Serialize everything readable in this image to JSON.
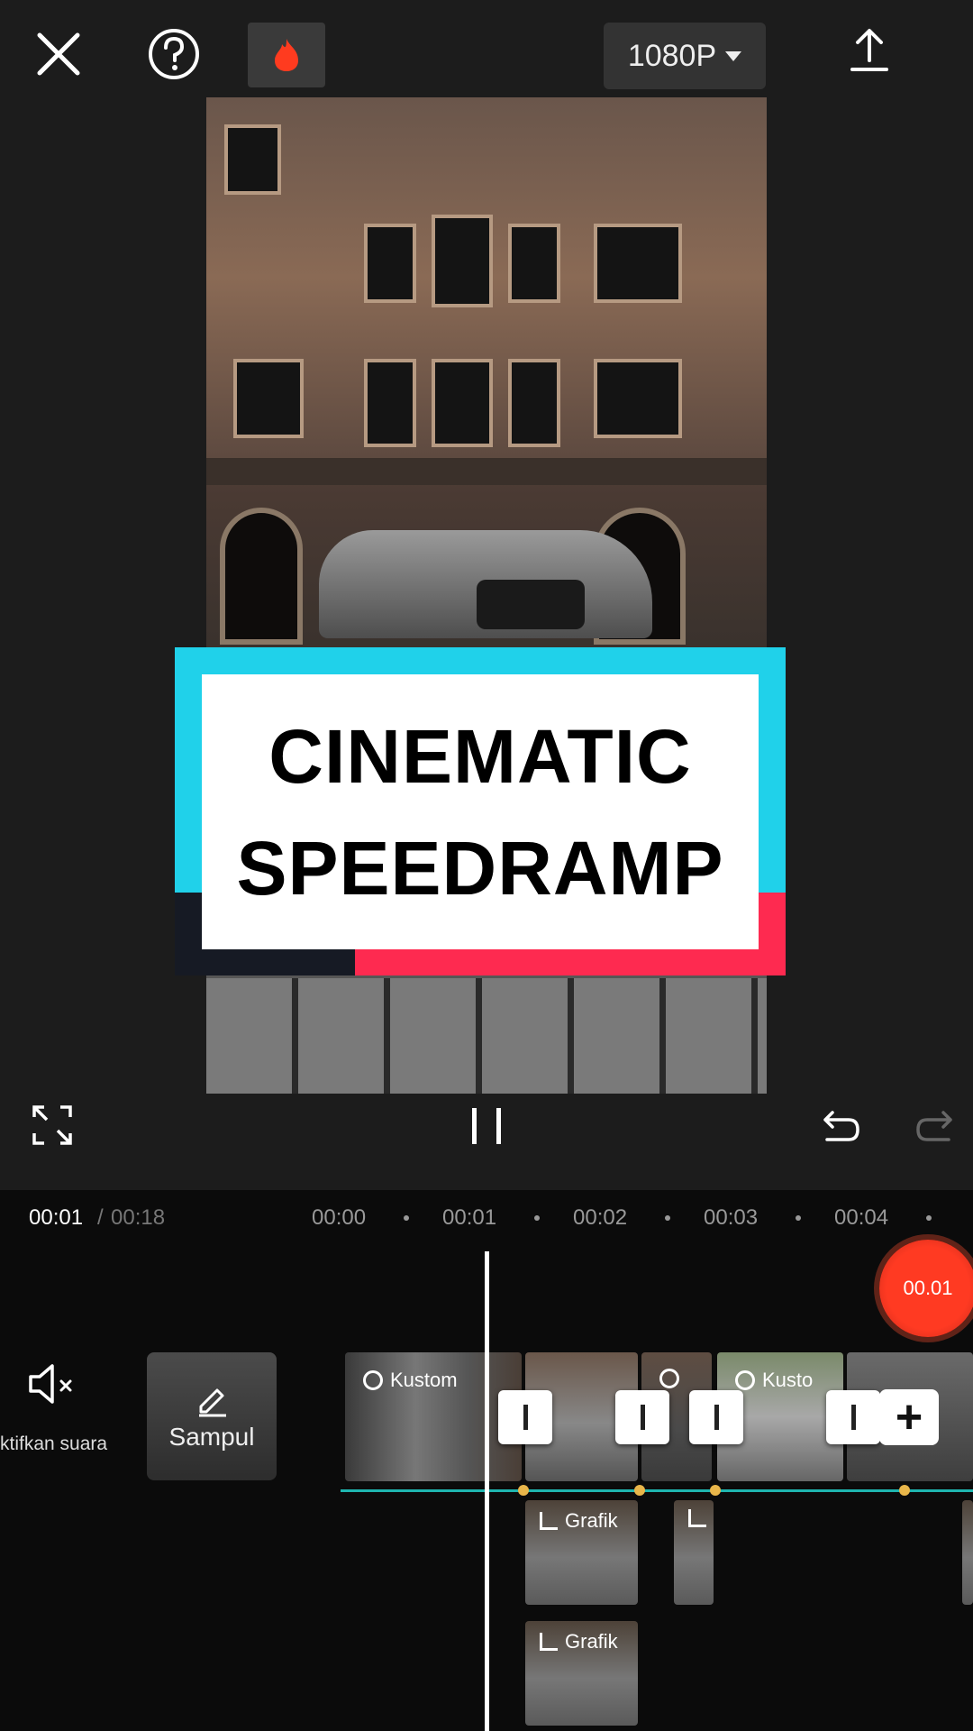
{
  "topbar": {
    "resolution": "1080P"
  },
  "preview": {
    "title_line1": "CINEMATIC",
    "title_line2": "SPEEDRAMP"
  },
  "timeline": {
    "current_time": "00:01",
    "separator": "/",
    "total_time": "00:18",
    "ruler": [
      "00:00",
      "00:01",
      "00:02",
      "00:03",
      "00:04"
    ],
    "record_badge": "00.01",
    "mute_label": "ktifkan suara",
    "cover_label": "Sampul",
    "clips": [
      {
        "label": "Kustom"
      },
      {
        "label": ""
      },
      {
        "label": ""
      },
      {
        "label": "Kusto"
      }
    ],
    "sub_tracks": [
      {
        "label": "Grafik"
      },
      {
        "label": ""
      },
      {
        "label": "Grafik"
      }
    ]
  },
  "icons": {
    "close": "close-icon",
    "help": "help-icon",
    "flame": "flame-icon",
    "export": "export-icon",
    "fullscreen": "fullscreen-icon",
    "pause": "pause-icon",
    "undo": "undo-icon",
    "redo": "redo-icon",
    "mute": "speaker-mute-icon",
    "edit": "pencil-icon",
    "add": "plus-icon"
  },
  "colors": {
    "accent_cyan": "#20d1ea",
    "accent_red": "#fe2a50",
    "record": "#ff3a22",
    "keyframe": "#e9b64a",
    "track_line": "#1fb6b0"
  }
}
